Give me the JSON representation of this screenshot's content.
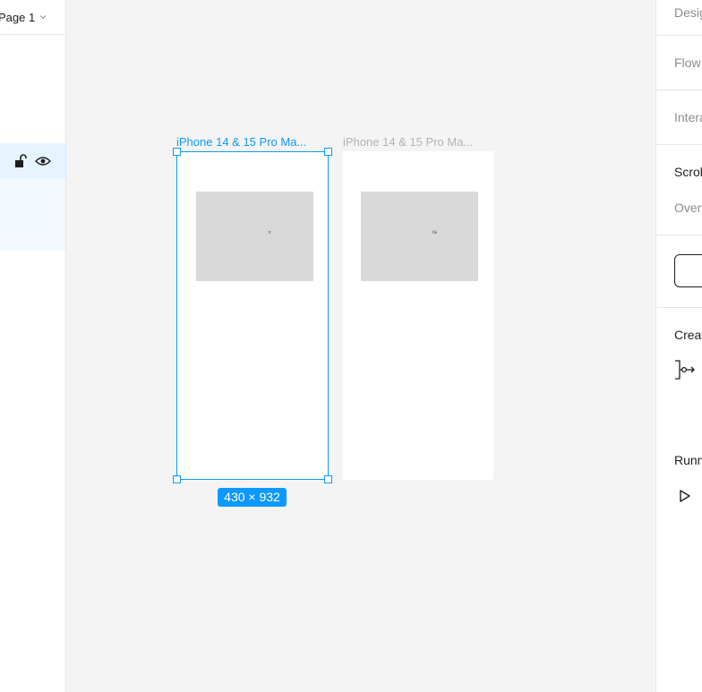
{
  "left_panel": {
    "page_label": "Page 1"
  },
  "canvas": {
    "frames": [
      {
        "title": "iPhone 14 & 15 Pro Ma...",
        "placeholder_glyph": "×",
        "selected": true
      },
      {
        "title": "iPhone 14 & 15 Pro Ma...",
        "placeholder_glyph": "№",
        "selected": false
      }
    ],
    "size_badge": "430 × 932"
  },
  "right_panel": {
    "tab_design": "Design",
    "flow": "Flow",
    "interactions": "Interactions",
    "scroll": "Scroll",
    "overflow": "Overflow",
    "create": "Create",
    "running": "Running"
  },
  "colors": {
    "accent": "#0d99ff",
    "canvas_bg": "#f4f4f4",
    "placeholder": "#d9d9d9"
  },
  "icons": [
    "chevron-down-icon",
    "unlock-icon",
    "eye-icon",
    "flow-start-icon",
    "play-icon"
  ]
}
